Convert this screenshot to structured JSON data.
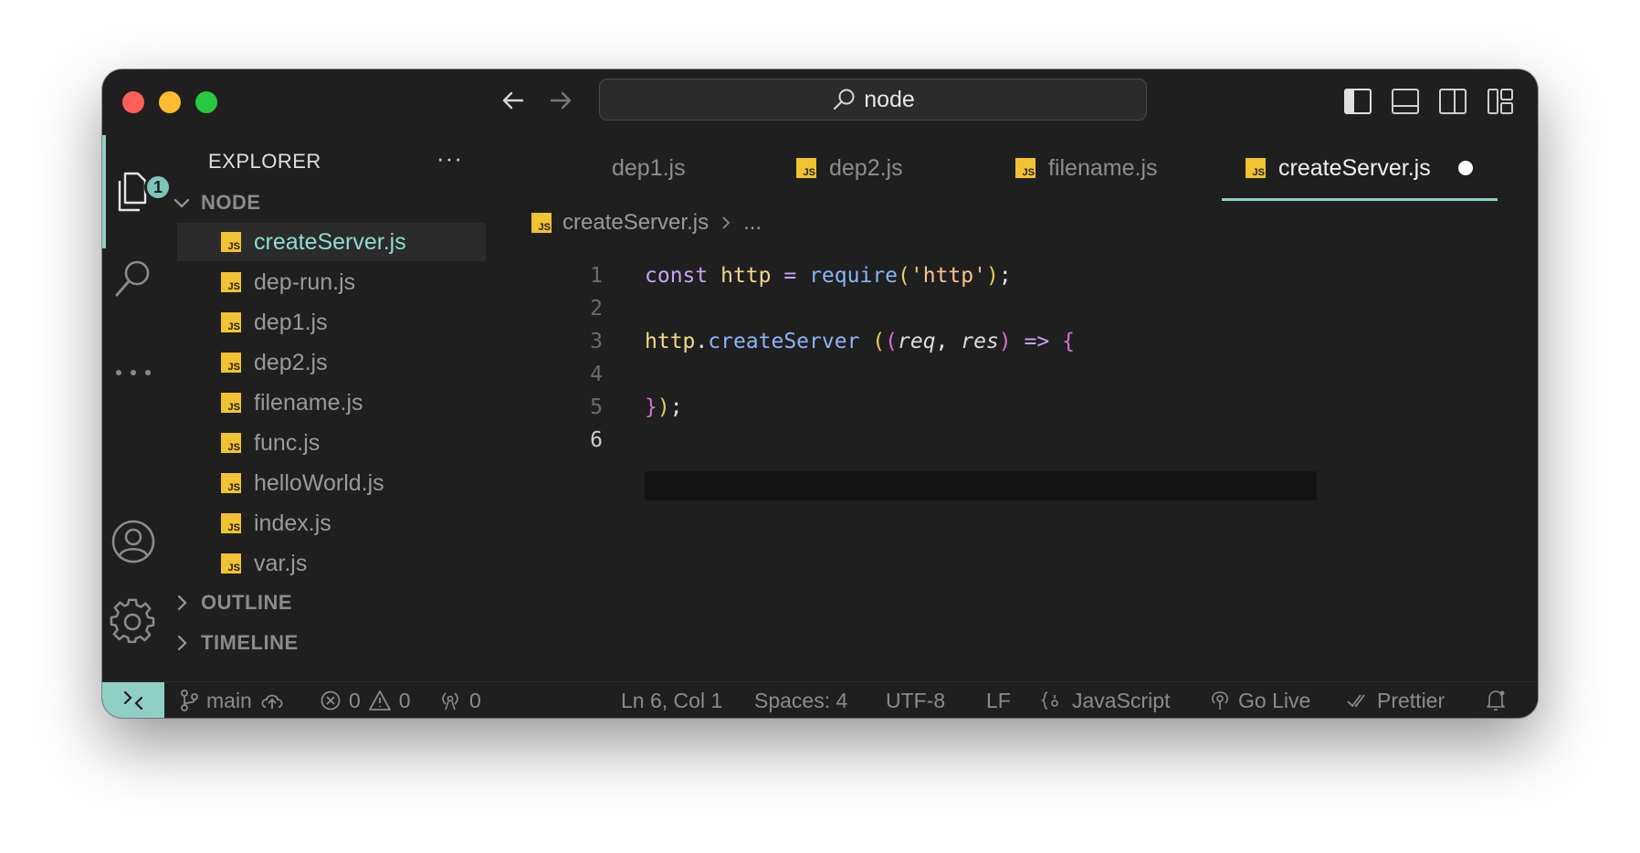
{
  "window": {
    "search_text": "node"
  },
  "sidebar": {
    "title": "EXPLORER",
    "more": "···",
    "folder": "NODE",
    "files": [
      {
        "name": "createServer.js",
        "active": true
      },
      {
        "name": "dep-run.js",
        "active": false
      },
      {
        "name": "dep1.js",
        "active": false
      },
      {
        "name": "dep2.js",
        "active": false
      },
      {
        "name": "filename.js",
        "active": false
      },
      {
        "name": "func.js",
        "active": false
      },
      {
        "name": "helloWorld.js",
        "active": false
      },
      {
        "name": "index.js",
        "active": false
      },
      {
        "name": "var.js",
        "active": false
      }
    ],
    "outline": "OUTLINE",
    "timeline": "TIMELINE"
  },
  "activity": {
    "explorer_badge": "1"
  },
  "tabs": [
    {
      "label": "dep1.js",
      "active": false
    },
    {
      "label": "dep2.js",
      "active": false
    },
    {
      "label": "filename.js",
      "active": false
    },
    {
      "label": "createServer.js",
      "active": true,
      "dirty": true
    }
  ],
  "tab_more": "···",
  "breadcrumb": {
    "file": "createServer.js",
    "rest": "..."
  },
  "editor": {
    "line_numbers": [
      "1",
      "2",
      "3",
      "4",
      "5",
      "6"
    ],
    "current_line": "6"
  },
  "status": {
    "branch": "main",
    "errors": "0",
    "warnings": "0",
    "ports": "0",
    "position": "Ln 6, Col 1",
    "spaces": "Spaces: 4",
    "encoding": "UTF-8",
    "eol": "LF",
    "language": "JavaScript",
    "golive": "Go Live",
    "prettier": "Prettier"
  },
  "colors": {
    "accent": "#8fcfc6",
    "js_icon": "#f1c232",
    "background": "#1f1f1f"
  }
}
